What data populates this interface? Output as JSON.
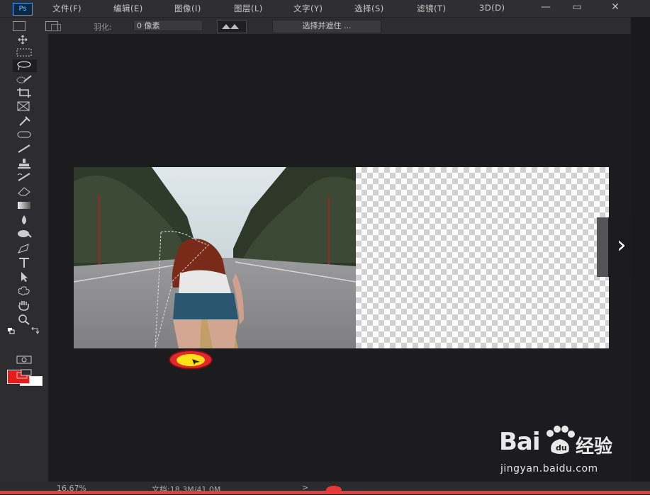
{
  "app": {
    "logo_text": "Ps"
  },
  "menu": [
    {
      "label": "文件(F)"
    },
    {
      "label": "编辑(E)"
    },
    {
      "label": "图像(I)"
    },
    {
      "label": "图层(L)"
    },
    {
      "label": "文字(Y)"
    },
    {
      "label": "选择(S)"
    },
    {
      "label": "滤镜(T)"
    },
    {
      "label": "3D(D)"
    }
  ],
  "window_controls": {
    "minimize": "—",
    "restore": "▭",
    "close": "✕"
  },
  "options": {
    "feather_label": "羽化:",
    "feather_value": "0 像素",
    "select_mask_label": "选择并遮住 ..."
  },
  "colors": {
    "foreground": "#e51c1b",
    "background": "#ffffff",
    "accent": "#e0403a"
  },
  "status": {
    "zoom": "16.67%",
    "doc": "文档:18.3M/41.0M",
    "chevron": ">"
  },
  "nav": {
    "next": "›"
  },
  "watermark": {
    "logo_text": "Bai",
    "brand": "经验",
    "url": "jingyan.baidu.com"
  }
}
